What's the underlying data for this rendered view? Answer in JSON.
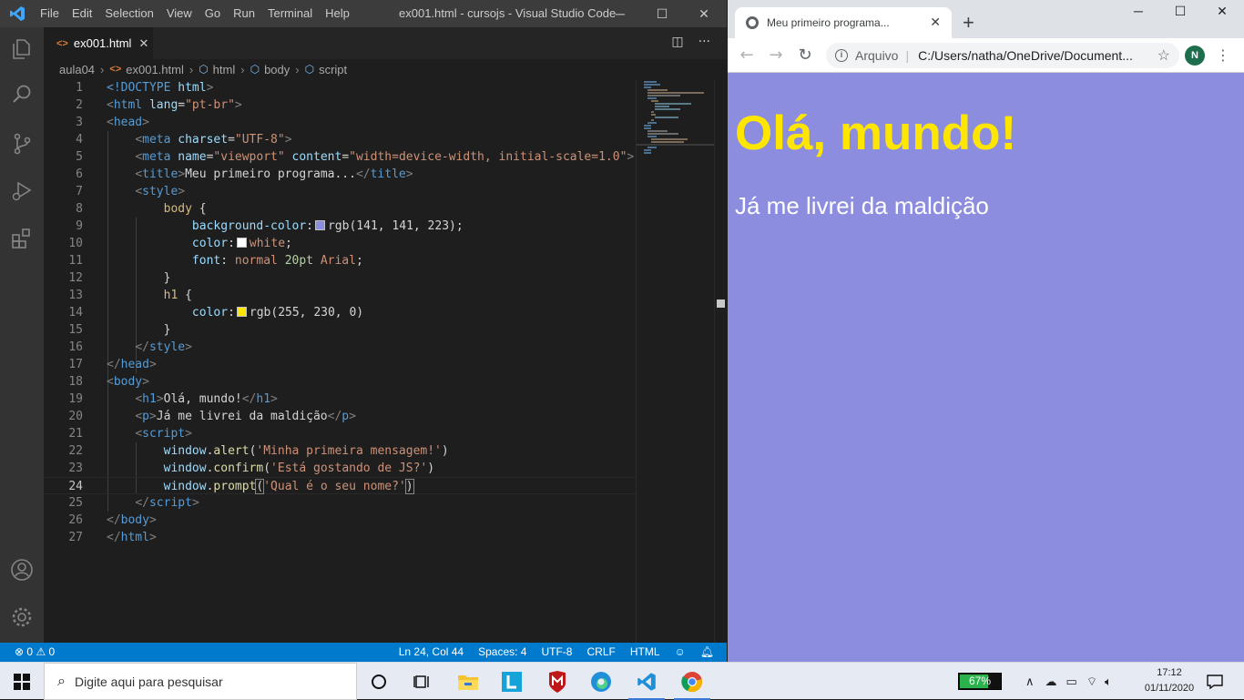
{
  "vscode": {
    "menu": [
      "File",
      "Edit",
      "Selection",
      "View",
      "Go",
      "Run",
      "Terminal",
      "Help"
    ],
    "window_title": "ex001.html - cursojs - Visual Studio Code",
    "tab": {
      "label": "ex001.html",
      "close": "✕"
    },
    "breadcrumb": [
      "aula04",
      "ex001.html",
      "html",
      "body",
      "script"
    ],
    "line_numbers": [
      "1",
      "2",
      "3",
      "4",
      "5",
      "6",
      "7",
      "8",
      "9",
      "10",
      "11",
      "12",
      "13",
      "14",
      "15",
      "16",
      "17",
      "18",
      "19",
      "20",
      "21",
      "22",
      "23",
      "24",
      "25",
      "26",
      "27"
    ],
    "code": {
      "l1_doctype": "<!DOCTYPE",
      "l1_html": "html",
      "l2_tag": "html",
      "l2_attr": "lang",
      "l2_val": "\"pt-br\"",
      "l3_tag": "head",
      "l4_tag": "meta",
      "l4_attr": "charset",
      "l4_val": "\"UTF-8\"",
      "l5_tag": "meta",
      "l5_attr1": "name",
      "l5_val1": "\"viewport\"",
      "l5_attr2": "content",
      "l5_val2": "\"width=device-width, initial-scale=1.0\"",
      "l6_tag": "title",
      "l6_text": "Meu primeiro programa...",
      "l7_tag": "style",
      "l8_sel": "body",
      "l9_prop": "background-color",
      "l9_val": "rgb(141, 141, 223)",
      "l10_prop": "color",
      "l10_val": "white",
      "l11_prop": "font",
      "l11_v1": "normal",
      "l11_v2": "20pt",
      "l11_v3": "Arial",
      "l13_sel": "h1",
      "l14_prop": "color",
      "l14_val": "rgb(255, 230, 0)",
      "l16_tag": "style",
      "l17_tag": "head",
      "l18_tag": "body",
      "l19_tag": "h1",
      "l19_text": "Olá, mundo!",
      "l20_tag": "p",
      "l20_text": "Já me livrei da maldição",
      "l21_tag": "script",
      "l22_obj": "window",
      "l22_fn": "alert",
      "l22_str": "'Minha primeira mensagem!'",
      "l23_obj": "window",
      "l23_fn": "confirm",
      "l23_str": "'Está gostando de JS?'",
      "l24_obj": "window",
      "l24_fn": "prompt",
      "l24_str": "'Qual é o seu nome?'",
      "l25_tag": "script",
      "l26_tag": "body",
      "l27_tag": "html"
    },
    "colors": {
      "swatch_bg": "#8d8ddf",
      "swatch_white": "#ffffff",
      "swatch_yellow": "#ffe600"
    },
    "status": {
      "errors": "0",
      "warnings": "0",
      "position": "Ln 24, Col 44",
      "spaces": "Spaces: 4",
      "encoding": "UTF-8",
      "eol": "CRLF",
      "language": "HTML"
    }
  },
  "chrome": {
    "tab_title": "Meu primeiro programa...",
    "scheme_label": "Arquivo",
    "url": "C:/Users/natha/OneDrive/Document...",
    "avatar_letter": "N"
  },
  "page": {
    "heading": "Olá, mundo!",
    "paragraph": "Já me livrei da maldição"
  },
  "taskbar": {
    "search_placeholder": "Digite aqui para pesquisar",
    "battery": "67%",
    "battery_level": 0.67,
    "time": "17:12",
    "date": "01/11/2020",
    "icons": [
      "task-view-icon",
      "file-explorer-icon",
      "l-app-icon",
      "mcafee-icon",
      "edge-icon",
      "vscode-icon",
      "chrome-icon"
    ]
  }
}
